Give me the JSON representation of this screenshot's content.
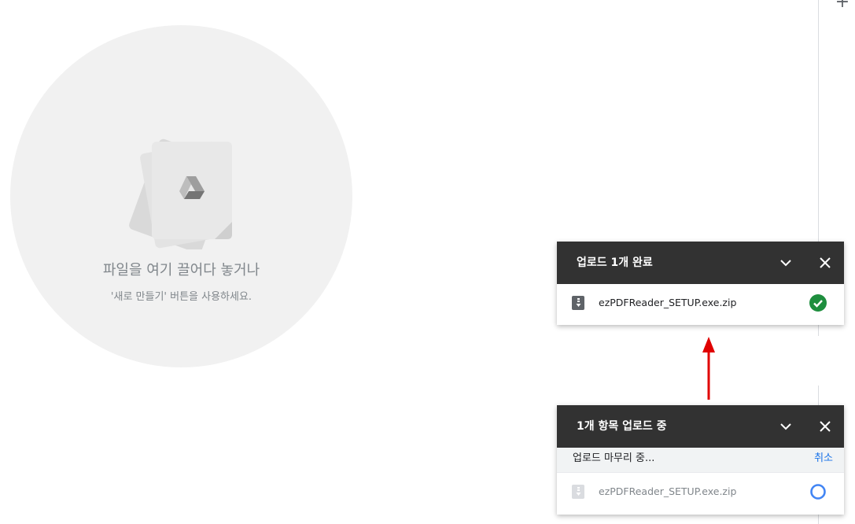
{
  "toolbar": {
    "add_icon": "plus-icon",
    "add_glyph": "+"
  },
  "drop_zone": {
    "title": "파일을 여기 끌어다 놓거나",
    "subtitle": "'새로 만들기' 버튼을 사용하세요.",
    "icon": "drive-logo-icon"
  },
  "upload_complete": {
    "title": "업로드 1개 완료",
    "file_name": "ezPDFReader_SETUP.exe.zip",
    "status_icon": "check-circle-icon",
    "status_color": "#1e8e3e"
  },
  "upload_progress": {
    "title": "1개 항목 업로드 중",
    "status_text": "업로드 마무리 중...",
    "cancel_label": "취소",
    "file_name": "ezPDFReader_SETUP.exe.zip",
    "status_icon": "progress-ring-icon",
    "status_color": "#4285f4"
  },
  "annotation": {
    "arrow_color": "#e00000",
    "direction": "up"
  }
}
